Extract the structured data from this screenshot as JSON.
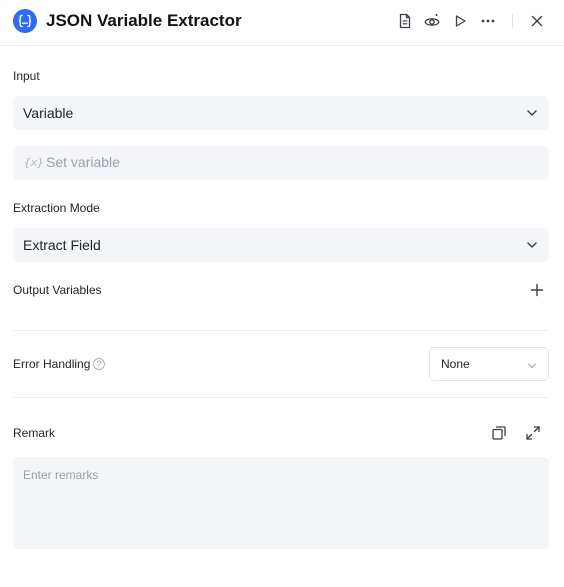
{
  "header": {
    "title": "JSON Variable Extractor",
    "logo_icon": "json-braces-icon",
    "actions": [
      "document-icon",
      "preview-icon",
      "run-icon",
      "more-icon",
      "close-icon"
    ]
  },
  "input": {
    "label": "Input",
    "source_value": "Variable",
    "variable_prefix": "{x}",
    "variable_placeholder": "Set variable"
  },
  "extraction": {
    "label": "Extraction Mode",
    "value": "Extract Field"
  },
  "output": {
    "label": "Output Variables",
    "add_icon": "plus-icon"
  },
  "error_handling": {
    "label": "Error Handling",
    "help_symbol": "?",
    "value": "None"
  },
  "remark": {
    "label": "Remark",
    "placeholder": "Enter remarks",
    "icons": [
      "copy-icon",
      "expand-icon"
    ]
  },
  "colors": {
    "accent": "#2f6bf6",
    "field_bg": "#f4f5f8",
    "divider": "#eceef2"
  }
}
